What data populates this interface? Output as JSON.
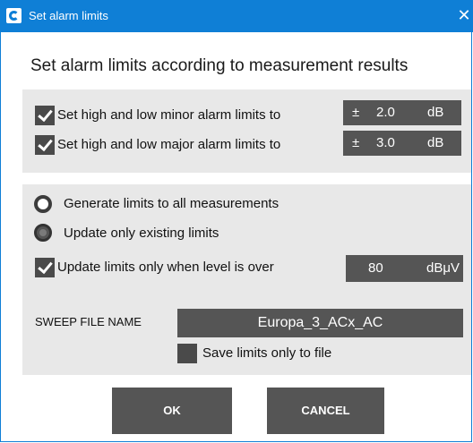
{
  "window": {
    "title": "Set alarm limits",
    "close_glyph": "✕",
    "accent": "#0f7fd6"
  },
  "heading": "Set alarm limits according to measurement results",
  "limits": {
    "minor": {
      "label": "Set high and low minor alarm limits to",
      "checked": true,
      "sign": "±",
      "value": "2.0",
      "unit": "dB"
    },
    "major": {
      "label": "Set high and low major alarm limits to",
      "checked": true,
      "sign": "±",
      "value": "3.0",
      "unit": "dB"
    }
  },
  "mode": {
    "options": [
      {
        "label": "Generate limits to all measurements",
        "selected": false
      },
      {
        "label": "Update only existing limits",
        "selected": true
      }
    ]
  },
  "level": {
    "label": "Update limits only when level is over",
    "checked": true,
    "value": "80",
    "unit": "dBμV"
  },
  "sweep": {
    "label": "SWEEP FILE NAME",
    "value": "Europa_3_ACx_AC"
  },
  "save_only": {
    "label": "Save limits only to file",
    "checked": false
  },
  "buttons": {
    "ok": "OK",
    "cancel": "CANCEL"
  }
}
